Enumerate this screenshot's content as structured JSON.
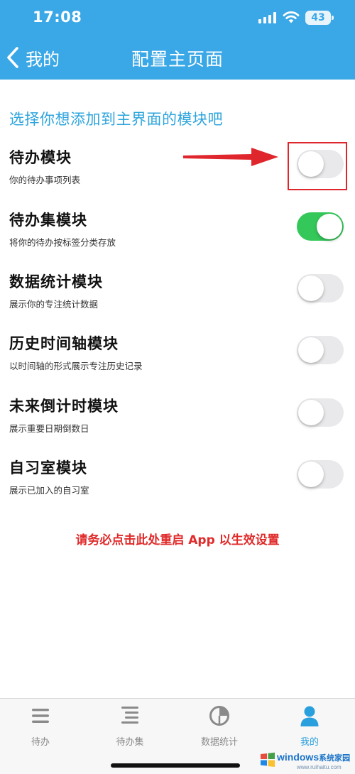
{
  "status_bar": {
    "time": "17:08",
    "battery": "43",
    "icons": [
      "signal-icon",
      "wifi-icon",
      "battery-icon"
    ]
  },
  "nav": {
    "back_label": "我的",
    "title": "配置主页面"
  },
  "section_heading": "选择你想添加到主界面的模块吧",
  "modules": [
    {
      "title": "待办模块",
      "desc": "你的待办事项列表",
      "enabled": false
    },
    {
      "title": "待办集模块",
      "desc": "将你的待办按标签分类存放",
      "enabled": true
    },
    {
      "title": "数据统计模块",
      "desc": "展示你的专注统计数据",
      "enabled": false
    },
    {
      "title": "历史时间轴模块",
      "desc": "以时间轴的形式展示专注历史记录",
      "enabled": false
    },
    {
      "title": "未来倒计时模块",
      "desc": "展示重要日期倒数日",
      "enabled": false
    },
    {
      "title": "自习室模块",
      "desc": "展示已加入的自习室",
      "enabled": false
    }
  ],
  "restart_notice": "请务必点击此处重启 App 以生效设置",
  "tabs": [
    {
      "label": "待办",
      "icon": "todo-list-icon",
      "active": false
    },
    {
      "label": "待办集",
      "icon": "todo-set-icon",
      "active": false
    },
    {
      "label": "数据统计",
      "icon": "pie-chart-icon",
      "active": false
    },
    {
      "label": "我的",
      "icon": "profile-icon",
      "active": true
    }
  ],
  "watermark": {
    "brand": "windows",
    "suffix": "系统家园",
    "url": "www.ruihaitu.com"
  },
  "colors": {
    "header": "#3aa7e6",
    "accent": "#2ca4dd",
    "toggle_on": "#34c759",
    "toggle_off": "#e9e9eb",
    "alert": "#e02a2a",
    "tab_active": "#2a9fde",
    "tab_inactive": "#8a8a8a"
  }
}
